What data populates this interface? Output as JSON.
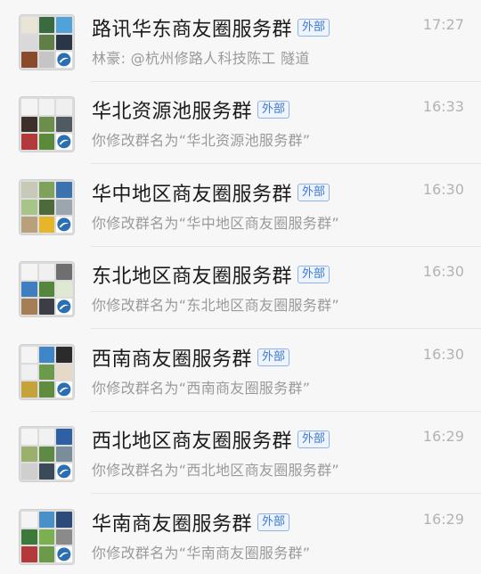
{
  "chats": [
    {
      "title": "路讯华东商友圈服务群",
      "tag": "外部",
      "subtitle": "林豪: @杭州修路人科技陈工  隧道",
      "time": "17:27",
      "avatar_colors": [
        "#e9e4d6",
        "#3a6b3e",
        "#4fa3d9",
        "#d9d9d9",
        "#5f7f46",
        "#2b3548",
        "#8a4b2d",
        "#c5c5c5",
        "#2a6fb3"
      ]
    },
    {
      "title": "华北资源池服务群",
      "tag": "外部",
      "subtitle": "你修改群名为“华北资源池服务群”",
      "time": "16:33",
      "avatar_colors": [
        "#f4f4f4",
        "#f2f2f2",
        "#efefef",
        "#3d2f2a",
        "#6b8f4a",
        "#4f5a63",
        "#b33a3a",
        "#5a8a3a",
        "#2a6fb3"
      ]
    },
    {
      "title": "华中地区商友圈服务群",
      "tag": "外部",
      "subtitle": "你修改群名为“华中地区商友圈服务群”",
      "time": "16:30",
      "avatar_colors": [
        "#c9c9b8",
        "#7ea25a",
        "#3d72b0",
        "#a7c48a",
        "#4d6a3a",
        "#9ba6ae",
        "#b8a07a",
        "#e6b52a",
        "#2a6fb3"
      ]
    },
    {
      "title": "东北地区商友圈服务群",
      "tag": "外部",
      "subtitle": "你修改群名为“东北地区商友圈服务群”",
      "time": "16:30",
      "avatar_colors": [
        "#f4f4f4",
        "#f0f0f0",
        "#6f6f6f",
        "#3f7fc0",
        "#56853e",
        "#dfe9d2",
        "#a67e56",
        "#3b3f45",
        "#2a6fb3"
      ]
    },
    {
      "title": "西南商友圈服务群",
      "tag": "外部",
      "subtitle": "你修改群名为“西南商友圈服务群”",
      "time": "16:30",
      "avatar_colors": [
        "#f4f4f4",
        "#3f86c6",
        "#2b2b2b",
        "#f0f0f0",
        "#6a9a4a",
        "#e8d8c8",
        "#c4a33a",
        "#5f8c3f",
        "#2a6fb3"
      ]
    },
    {
      "title": "西北地区商友圈服务群",
      "tag": "外部",
      "subtitle": "你修改群名为“西北地区商友圈服务群”",
      "time": "16:29",
      "avatar_colors": [
        "#f4f4f4",
        "#f1f1f1",
        "#2f5fa5",
        "#9cb06e",
        "#5f8a45",
        "#7a8d9a",
        "#cfcfcf",
        "#3a4a58",
        "#2a6fb3"
      ]
    },
    {
      "title": "华南商友圈服务群",
      "tag": "外部",
      "subtitle": "你修改群名为“华南商友圈服务群”",
      "time": "16:29",
      "avatar_colors": [
        "#f4f4f4",
        "#4a90c8",
        "#2c4a7a",
        "#3b7a3a",
        "#7ab050",
        "#8a8a8a",
        "#b23a3a",
        "#6a9a4a",
        "#2a6fb3"
      ]
    }
  ]
}
